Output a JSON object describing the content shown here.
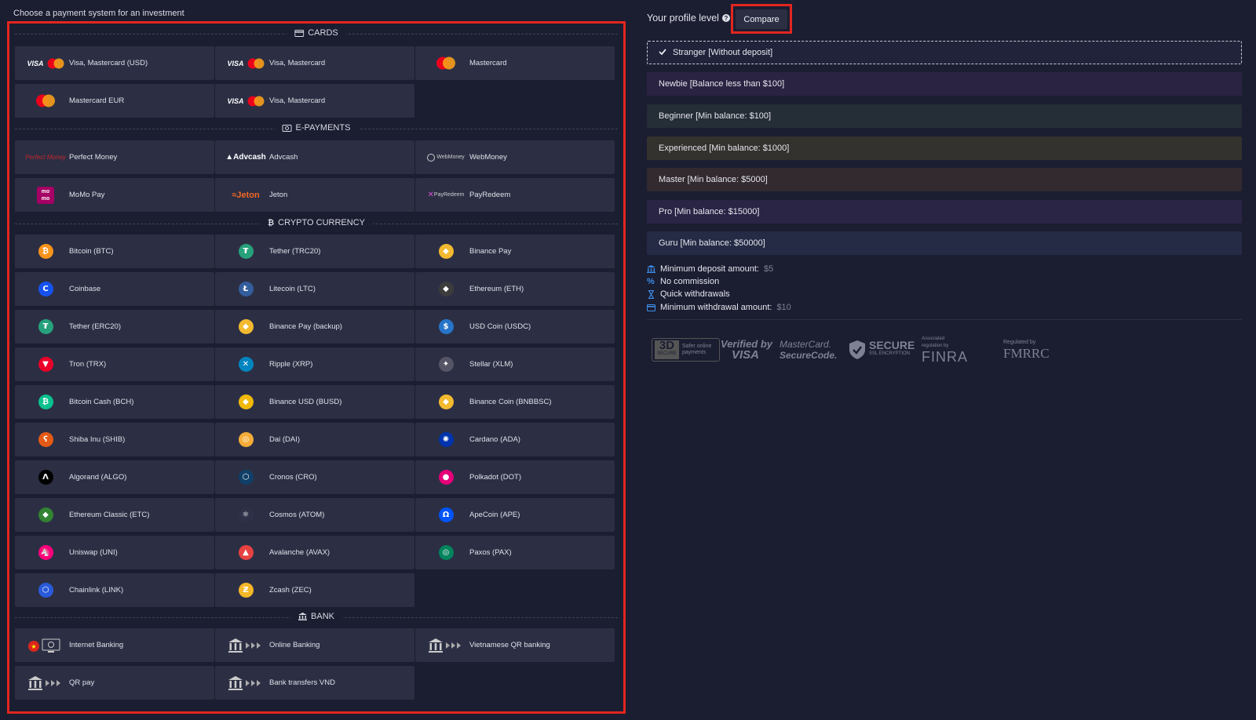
{
  "heading": "Choose a payment system for an investment",
  "sections": {
    "cards": "CARDS",
    "epayments": "E-PAYMENTS",
    "crypto": "CRYPTO CURRENCY",
    "bank": "BANK"
  },
  "methods": {
    "cards": [
      "Visa, Mastercard (USD)",
      "Visa, Mastercard",
      "Mastercard",
      "Mastercard EUR",
      "Visa, Mastercard"
    ],
    "epayments": [
      "Perfect Money",
      "Advcash",
      "WebMoney",
      "MoMo Pay",
      "Jeton",
      "PayRedeem"
    ],
    "crypto": [
      "Bitcoin (BTC)",
      "Tether (TRC20)",
      "Binance Pay",
      "Coinbase",
      "Litecoin (LTC)",
      "Ethereum (ETH)",
      "Tether (ERC20)",
      "Binance Pay (backup)",
      "USD Coin (USDC)",
      "Tron (TRX)",
      "Ripple (XRP)",
      "Stellar (XLM)",
      "Bitcoin Cash (BCH)",
      "Binance USD (BUSD)",
      "Binance Coin (BNBBSC)",
      "Shiba Inu (SHIB)",
      "Dai (DAI)",
      "Cardano (ADA)",
      "Algorand (ALGO)",
      "Cronos (CRO)",
      "Polkadot (DOT)",
      "Ethereum Classic (ETC)",
      "Cosmos (ATOM)",
      "ApeCoin (APE)",
      "Uniswap (UNI)",
      "Avalanche (AVAX)",
      "Paxos (PAX)",
      "Chainlink (LINK)",
      "Zcash (ZEC)"
    ],
    "bank": [
      "Internet Banking",
      "Online Banking",
      "Vietnamese QR banking",
      "QR pay",
      "Bank transfers VND"
    ]
  },
  "logos": {
    "visa": "VISA",
    "perfect_money": "Perfect Money",
    "advcash": "Advcash",
    "webmoney": "WebMoney",
    "momo": "mo mo",
    "jeton": "Jeton",
    "payredeem": "PayRedeem"
  },
  "profile": {
    "label": "Your profile level",
    "compare": "Compare",
    "levels": [
      "Stranger [Without deposit]",
      "Newbie [Balance less than $100]",
      "Beginner [Min balance: $100]",
      "Experienced [Min balance: $1000]",
      "Master [Min balance: $5000]",
      "Pro [Min balance: $15000]",
      "Guru [Min balance: $50000]"
    ],
    "level_colors": [
      "#20233a",
      "#2b2342",
      "#252d36",
      "#34322e",
      "#322a2f",
      "#2a2445",
      "#252a45"
    ]
  },
  "features": [
    {
      "label": "Minimum deposit amount:",
      "value": "$5"
    },
    {
      "label": "No commission",
      "value": ""
    },
    {
      "label": "Quick withdrawals",
      "value": ""
    },
    {
      "label": "Minimum withdrawal amount:",
      "value": "$10"
    }
  ],
  "badges": {
    "secure3d": "3D",
    "secure3d_sub": "SECURE",
    "secure3d_text": "Safer online payments",
    "verified": "Verified by",
    "verified_brand": "VISA",
    "mc_line1": "MasterCard.",
    "mc_line2": "SecureCode.",
    "secure": "SECURE",
    "secure_sub": "SSL ENCRYPTION",
    "finra_small": "Associated regulation by",
    "finra": "FINRA",
    "fmrrc_small": "Regulated by",
    "fmrrc": "FMRRC"
  },
  "colors": {
    "accent_red": "#e3261f",
    "tile_bg": "#2c2f44",
    "page_bg": "#1b1d31"
  }
}
